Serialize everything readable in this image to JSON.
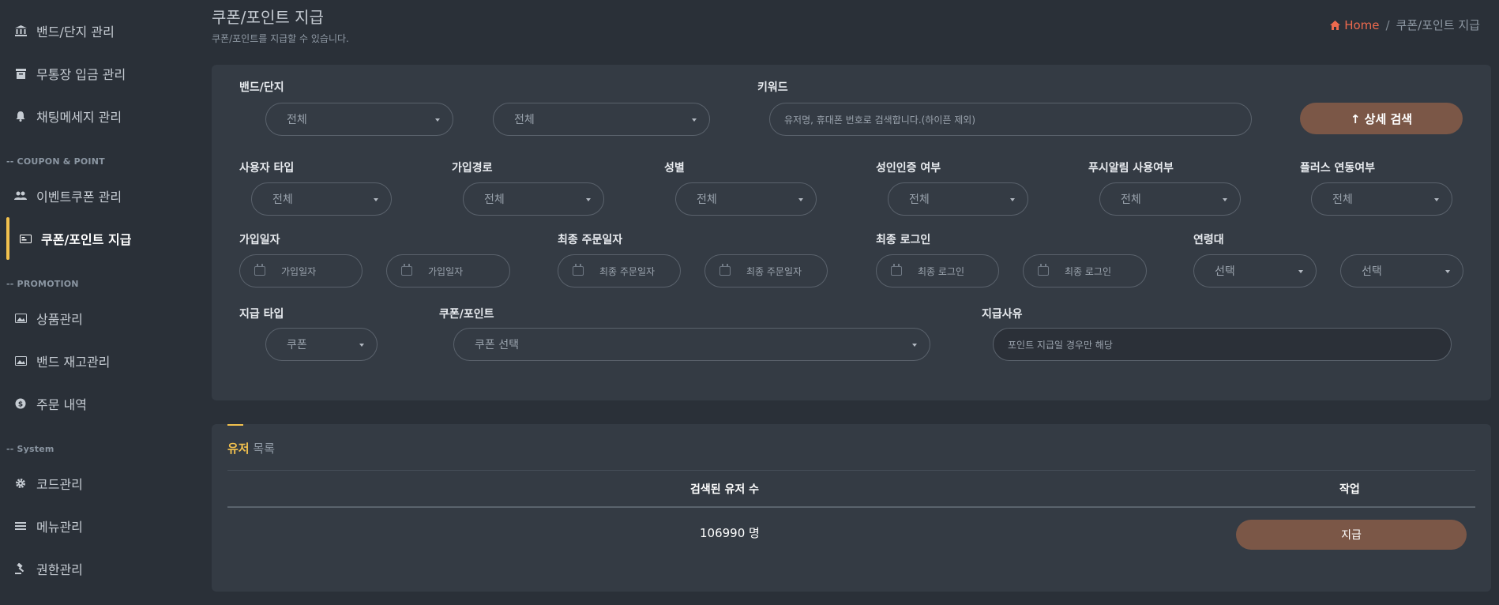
{
  "sidebar": {
    "items": [
      {
        "label": "밴드/단지 관리",
        "icon": "bank-icon"
      },
      {
        "label": "무통장 입금 관리",
        "icon": "archive-icon"
      },
      {
        "label": "채팅메세지 관리",
        "icon": "bell-icon"
      },
      {
        "label": "이벤트쿠폰 관리",
        "icon": "users-icon"
      },
      {
        "label": "쿠폰/포인트 지급",
        "icon": "card-icon"
      },
      {
        "label": "상품관리",
        "icon": "image-icon"
      },
      {
        "label": "밴드 재고관리",
        "icon": "image-icon"
      },
      {
        "label": "주문 내역",
        "icon": "dollar-icon"
      },
      {
        "label": "코드관리",
        "icon": "gear-icon"
      },
      {
        "label": "메뉴관리",
        "icon": "menu-icon"
      },
      {
        "label": "권한관리",
        "icon": "gavel-icon"
      }
    ],
    "sections": [
      "-- COUPON & POINT",
      "-- PROMOTION",
      "-- System"
    ],
    "active_color": "#f2c14e"
  },
  "header": {
    "title": "쿠폰/포인트 지급",
    "subtitle": "쿠폰/포인트를 지급할 수 있습니다.",
    "breadcrumb_home": "Home",
    "breadcrumb_sep": "/",
    "breadcrumb_current": "쿠폰/포인트 지급",
    "home_color": "#ee6a4e"
  },
  "filters": {
    "band_label": "밴드/단지",
    "band_select_1": "전체",
    "band_select_2": "전체",
    "keyword_label": "키워드",
    "keyword_placeholder": "유저명, 휴대폰 번호로 검색합니다.(하이픈 제외)",
    "detail_search_button": "↑ 상세 검색",
    "user_type_label": "사용자 타입",
    "user_type_value": "전체",
    "signup_path_label": "가입경로",
    "signup_path_value": "전체",
    "gender_label": "성별",
    "gender_value": "전체",
    "adult_label": "성인인증 여부",
    "adult_value": "전체",
    "push_label": "푸시알림 사용여부",
    "push_value": "전체",
    "plus_label": "플러스 연동여부",
    "plus_value": "전체",
    "signup_date_label": "가입일자",
    "signup_date_from": "가입일자",
    "signup_date_to": "가입일자",
    "last_order_label": "최종 주문일자",
    "last_order_from": "최종 주문일자",
    "last_order_to": "최종 주문일자",
    "last_login_label": "최종 로그인",
    "last_login_from": "최종 로그인",
    "last_login_to": "최종 로그인",
    "age_label": "연령대",
    "age_from": "선택",
    "age_to": "선택",
    "pay_type_label": "지급 타입",
    "pay_type_value": "쿠폰",
    "coupon_point_label": "쿠폰/포인트",
    "coupon_point_value": "쿠폰 선택",
    "reason_label": "지급사유",
    "reason_placeholder": "포인트 지급일 경우만 해당"
  },
  "list": {
    "title_highlight": "유저",
    "title_rest": "목록",
    "col_count": "검색된 유저 수",
    "col_action": "작업",
    "count_value": "106990 명",
    "pay_button": "지급"
  }
}
